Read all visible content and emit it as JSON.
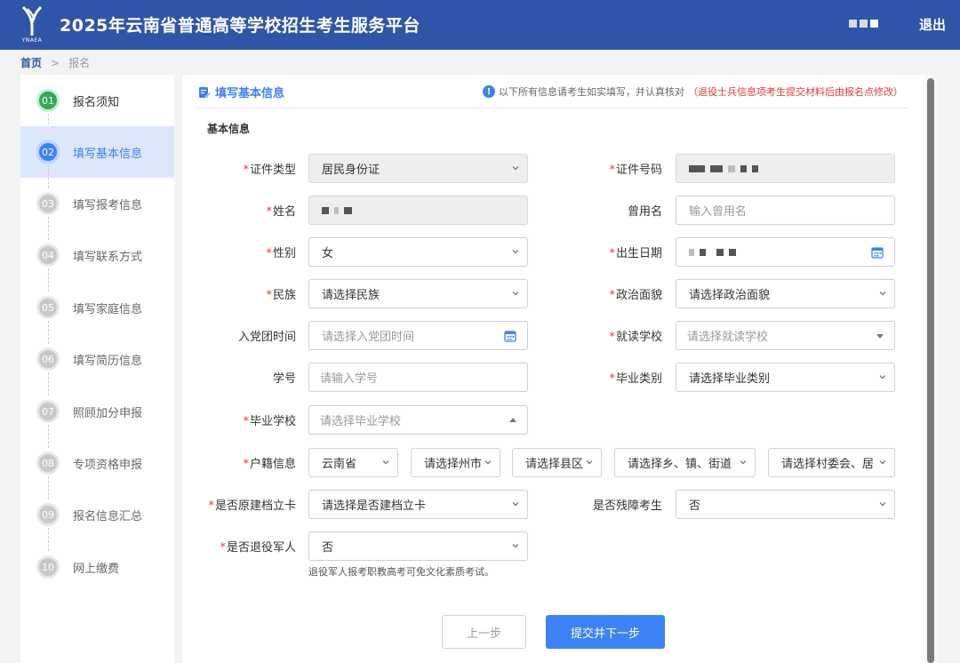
{
  "header": {
    "logo_text": "YNAEA",
    "title": "2025年云南省普通高等学校招生考生服务平台",
    "logout": "退出"
  },
  "breadcrumb": {
    "home": "首页",
    "separator": ">",
    "current": "报名"
  },
  "steps": [
    {
      "num": "01",
      "label": "报名须知",
      "state": "done"
    },
    {
      "num": "02",
      "label": "填写基本信息",
      "state": "active"
    },
    {
      "num": "03",
      "label": "填写报考信息",
      "state": "todo"
    },
    {
      "num": "04",
      "label": "填写联系方式",
      "state": "todo"
    },
    {
      "num": "05",
      "label": "填写家庭信息",
      "state": "todo"
    },
    {
      "num": "06",
      "label": "填写简历信息",
      "state": "todo"
    },
    {
      "num": "07",
      "label": "照顾加分申报",
      "state": "todo"
    },
    {
      "num": "08",
      "label": "专项资格申报",
      "state": "todo"
    },
    {
      "num": "09",
      "label": "报名信息汇总",
      "state": "todo"
    },
    {
      "num": "10",
      "label": "网上缴费",
      "state": "todo"
    }
  ],
  "panel": {
    "title": "填写基本信息",
    "notice": "以下所有信息请考生如实填写，并认真核对",
    "notice_red": "（退役士兵信息项考生提交材料后由报名点修改）",
    "section": "基本信息"
  },
  "form": {
    "id_type": {
      "label": "证件类型",
      "value": "居民身份证"
    },
    "id_number": {
      "label": "证件号码"
    },
    "name": {
      "label": "姓名"
    },
    "former_name": {
      "label": "曾用名",
      "placeholder": "输入曾用名"
    },
    "gender": {
      "label": "性别",
      "value": "女"
    },
    "birth_date": {
      "label": "出生日期"
    },
    "ethnicity": {
      "label": "民族",
      "value": "请选择民族"
    },
    "political_status": {
      "label": "政治面貌",
      "value": "请选择政治面貌"
    },
    "party_join_date": {
      "label": "入党团时间",
      "placeholder": "请选择入党团时间"
    },
    "current_school": {
      "label": "就读学校",
      "placeholder": "请选择就读学校"
    },
    "student_no": {
      "label": "学号",
      "placeholder": "请输入学号"
    },
    "graduate_type": {
      "label": "毕业类别",
      "value": "请选择毕业类别"
    },
    "graduate_school": {
      "label": "毕业学校",
      "placeholder": "请选择毕业学校"
    },
    "household": {
      "label": "户籍信息",
      "province": "云南省",
      "city": "请选择州市",
      "county": "请选择县区",
      "town": "请选择乡、镇、街道",
      "village": "请选择村委会、居"
    },
    "archive_card": {
      "label": "是否原建档立卡",
      "value": "请选择是否建档立卡"
    },
    "disabled": {
      "label": "是否残障考生",
      "value": "否"
    },
    "veteran": {
      "label": "是否退役军人",
      "value": "否",
      "hint": "退役军人报考职教高考可免文化素质考试。"
    }
  },
  "buttons": {
    "prev": "上一步",
    "next": "提交并下一步"
  }
}
